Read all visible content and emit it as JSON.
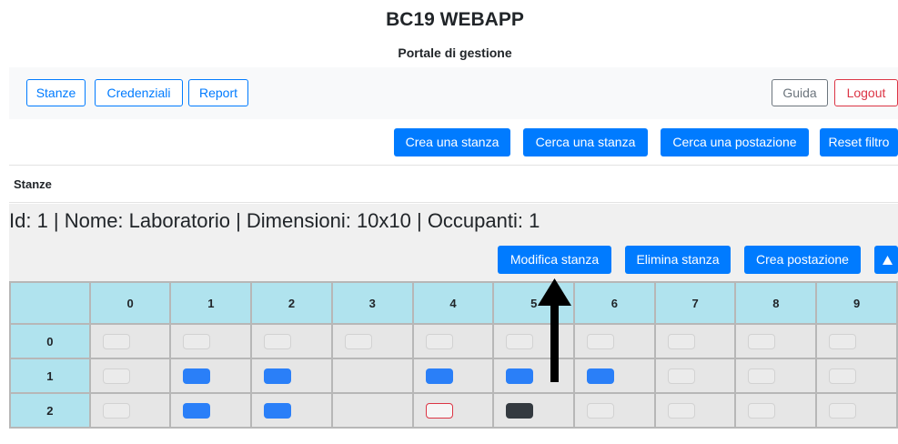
{
  "header": {
    "title": "BC19 WEBAPP",
    "subtitle": "Portale di gestione"
  },
  "nav": {
    "rooms": "Stanze",
    "credentials": "Credenziali",
    "report": "Report",
    "guide": "Guida",
    "logout": "Logout"
  },
  "actions": {
    "create_room": "Crea una stanza",
    "search_room": "Cerca una stanza",
    "search_station": "Cerca una postazione",
    "reset_filter": "Reset filtro"
  },
  "section_label": "Stanze",
  "room": {
    "title": "Id: 1 | Nome: Laboratorio | Dimensioni: 10x10 | Occupanti: 1",
    "edit": "Modifica stanza",
    "delete": "Elimina stanza",
    "create_station": "Crea postazione",
    "collapse_icon": "triangle-up-icon"
  },
  "colors": {
    "primary": "#007bff",
    "free": "#2a7ff8",
    "occupied": "#dc3545",
    "dark": "#343a40",
    "header_cell": "#b0e3ee"
  },
  "grid": {
    "columns": [
      "0",
      "1",
      "2",
      "3",
      "4",
      "5",
      "6",
      "7",
      "8",
      "9"
    ],
    "rows": [
      {
        "label": "0",
        "cells": [
          "empty",
          "empty",
          "empty",
          "empty",
          "empty",
          "empty",
          "empty",
          "empty",
          "empty",
          "empty"
        ]
      },
      {
        "label": "1",
        "cells": [
          "empty",
          "free",
          "free",
          "occupied",
          "free",
          "free",
          "free",
          "empty",
          "empty",
          "empty"
        ]
      },
      {
        "label": "2",
        "cells": [
          "empty",
          "free",
          "free",
          "occupied",
          "outline-red",
          "dark",
          "empty",
          "empty",
          "empty",
          "empty"
        ]
      }
    ]
  }
}
